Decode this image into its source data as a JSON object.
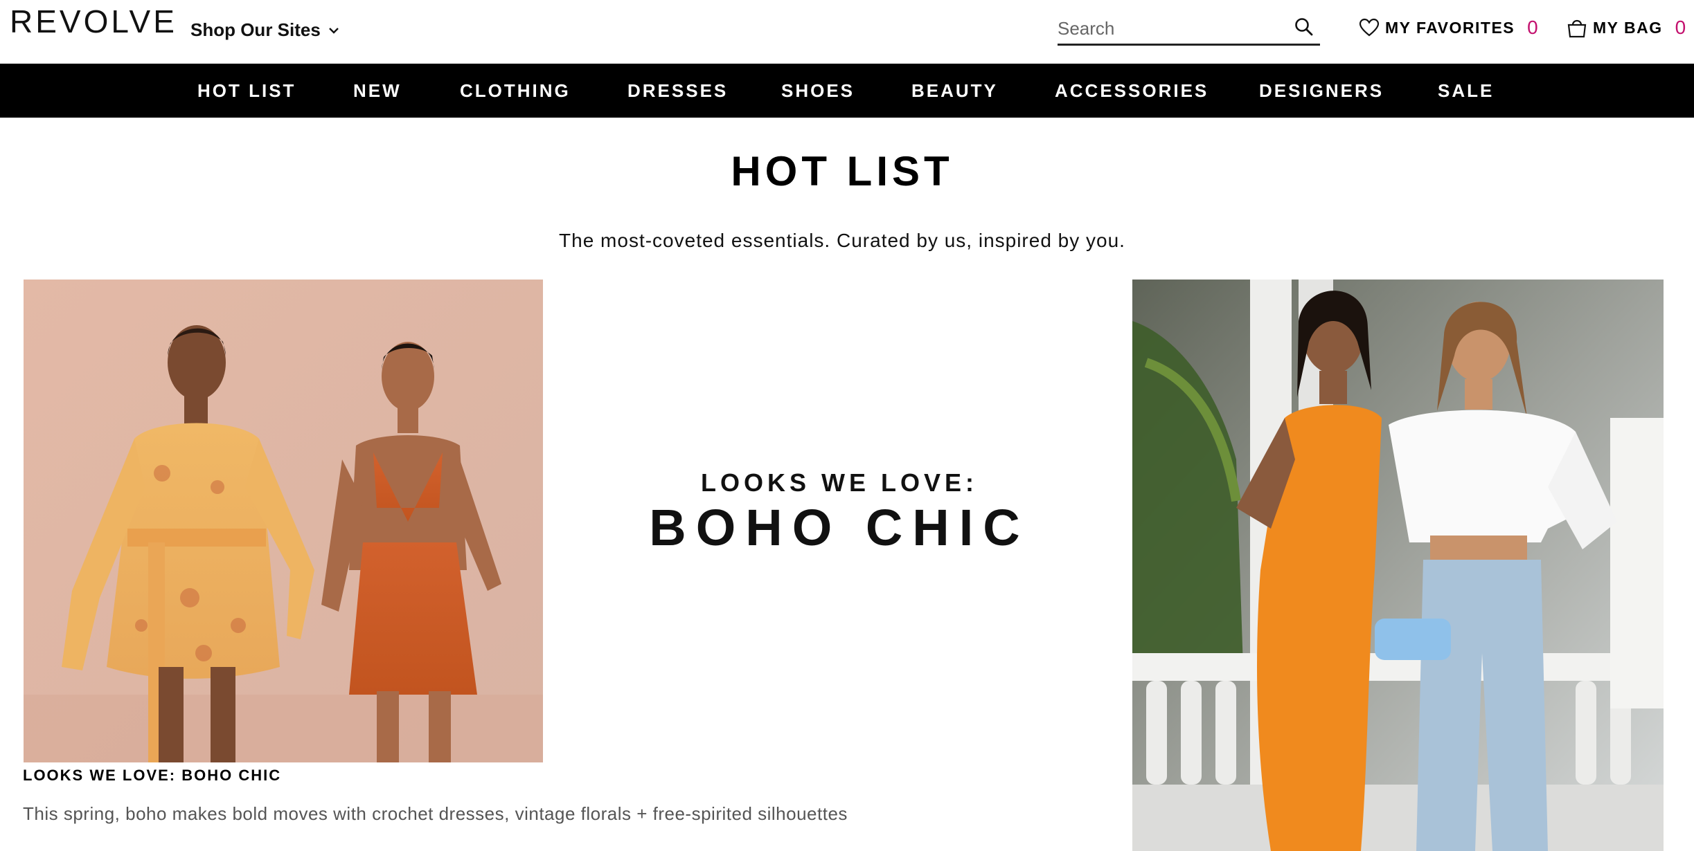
{
  "header": {
    "logo": "REVOLVE",
    "shop_sites": "Shop Our Sites",
    "search_placeholder": "Search",
    "favorites_label": "MY FAVORITES",
    "favorites_count": "0",
    "bag_label": "MY BAG",
    "bag_count": "0"
  },
  "nav": {
    "items": [
      "HOT LIST",
      "NEW",
      "CLOTHING",
      "DRESSES",
      "SHOES",
      "BEAUTY",
      "ACCESSORIES",
      "DESIGNERS",
      "SALE"
    ]
  },
  "main": {
    "title": "HOT LIST",
    "subtitle": "The most-coveted essentials. Curated by us, inspired by you.",
    "promo_line1": "LOOKS WE LOVE:",
    "promo_line2": "BOHO CHIC",
    "caption_title": "LOOKS WE LOVE: BOHO CHIC",
    "caption_text": "This spring, boho makes bold moves with crochet dresses, vintage florals + free-spirited silhouettes"
  },
  "colors": {
    "accent_pink": "#c3116e",
    "nav_bg": "#000000"
  },
  "icons": {
    "search": "search-icon",
    "favorites": "heart-icon",
    "bag": "shopping-bag-icon",
    "dropdown": "chevron-down-icon"
  }
}
